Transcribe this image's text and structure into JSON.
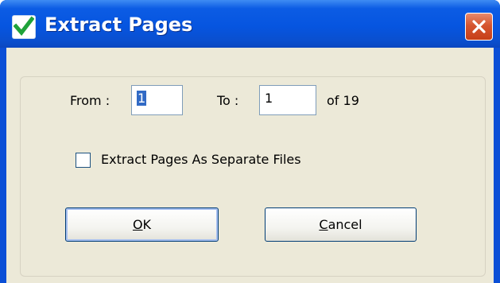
{
  "window": {
    "title": "Extract Pages"
  },
  "icons": {
    "app": "check-mark-icon",
    "close": "close-icon"
  },
  "colors": {
    "titlebar": "#0655e0",
    "close_button": "#d6552f",
    "dialog_bg": "#ece9d8",
    "selection": "#316ac5"
  },
  "range": {
    "from_label": "From :",
    "from_value": "1",
    "to_label": "To :",
    "to_value": "1",
    "of_label": "of 19"
  },
  "options": {
    "separate_files_label": "Extract Pages As Separate Files",
    "separate_files_checked": false
  },
  "buttons": {
    "ok_accel": "O",
    "ok_rest": "K",
    "cancel_accel": "C",
    "cancel_rest": "ancel"
  }
}
